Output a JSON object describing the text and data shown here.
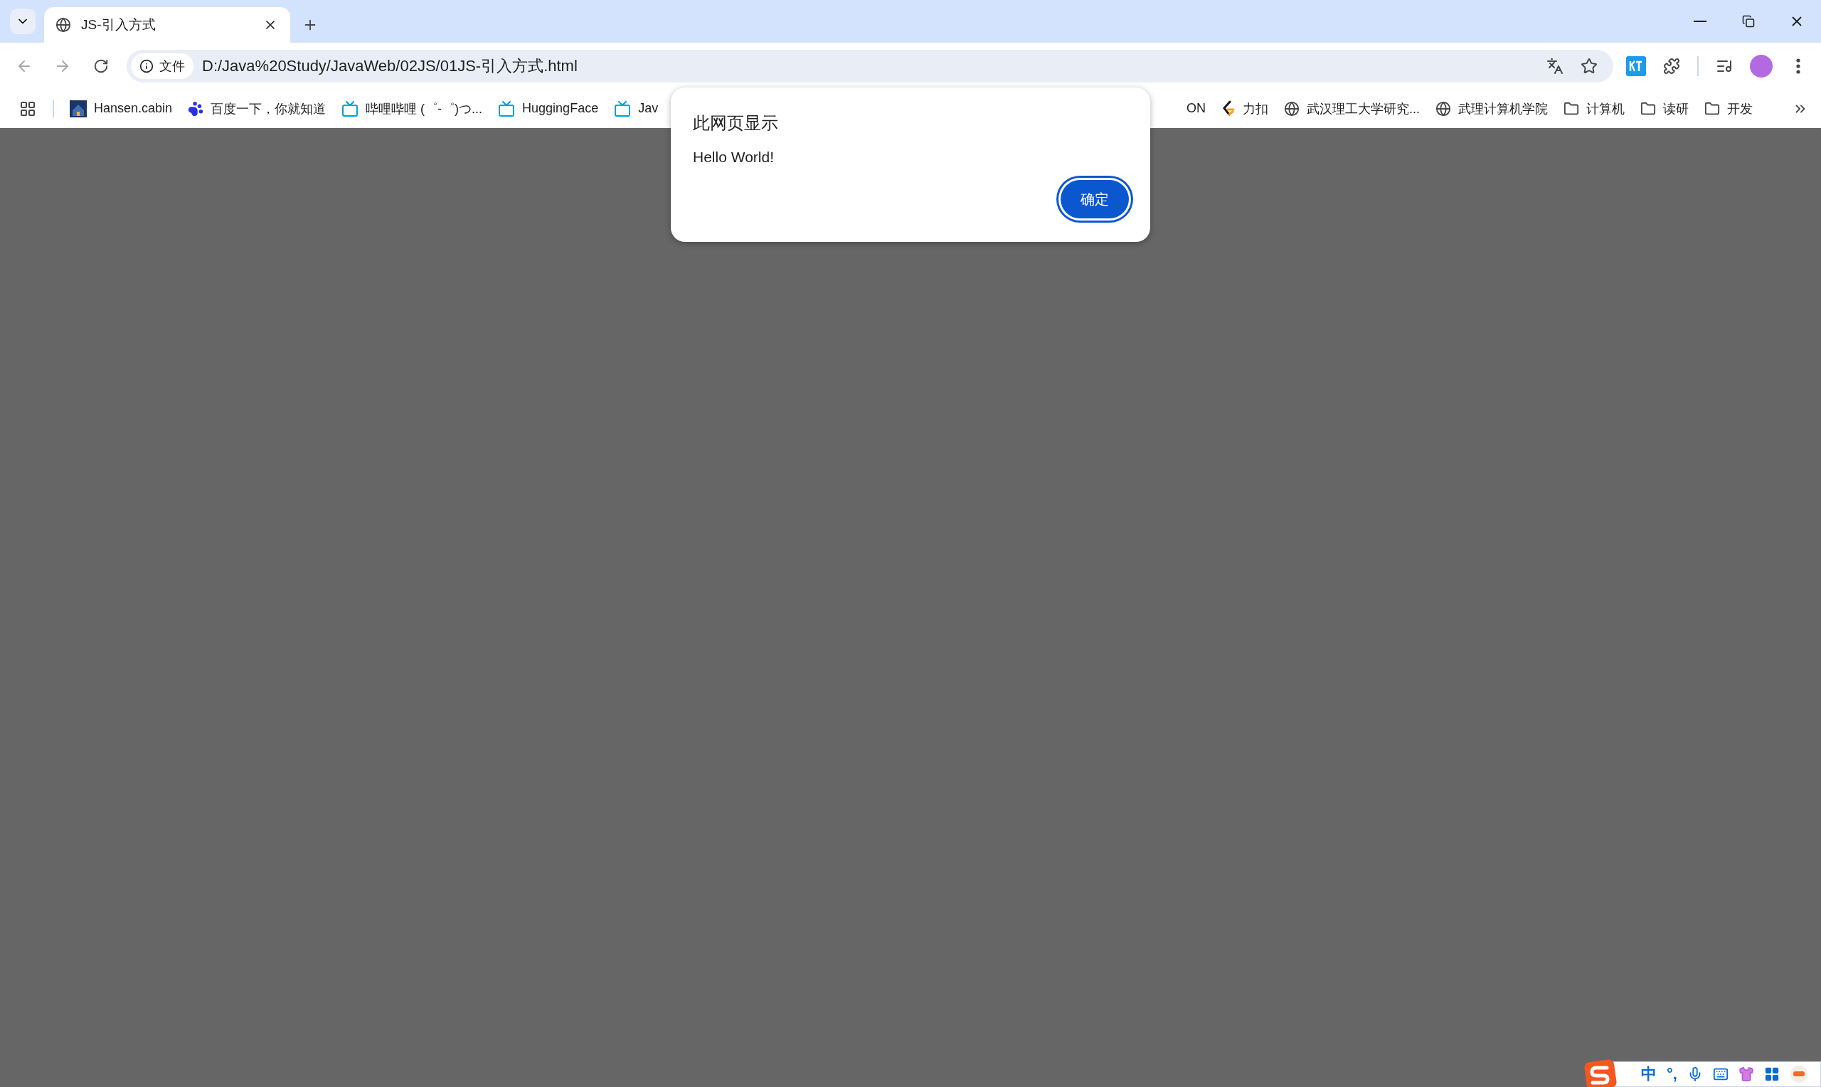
{
  "tab": {
    "title": "JS-引入方式"
  },
  "navigation": {
    "back_enabled": false,
    "forward_enabled": false
  },
  "address_bar": {
    "scheme_chip": "文件",
    "url": "D:/Java%20Study/JavaWeb/02JS/01JS-引入方式.html"
  },
  "bookmarks_left": [
    {
      "label": "Hansen.cabin",
      "kind": "house"
    },
    {
      "label": "百度一下，你就知道",
      "kind": "paw"
    },
    {
      "label": "哔哩哔哩 (゜-゜)つ...",
      "kind": "tv"
    },
    {
      "label": "HuggingFace",
      "kind": "tv"
    },
    {
      "label": "Jav",
      "kind": "tv"
    }
  ],
  "bookmarks_right": [
    {
      "label": "ON",
      "kind": "none"
    },
    {
      "label": "力扣",
      "kind": "leetcode"
    },
    {
      "label": "武汉理工大学研究...",
      "kind": "globe"
    },
    {
      "label": "武理计算机学院",
      "kind": "globe"
    },
    {
      "label": "计算机",
      "kind": "folder"
    },
    {
      "label": "读研",
      "kind": "folder"
    },
    {
      "label": "开发",
      "kind": "folder"
    }
  ],
  "dialog": {
    "title": "此网页显示",
    "message": "Hello World!",
    "button": "确定"
  },
  "ime_toolbar": {
    "mode": "中",
    "punctuation": "°,"
  }
}
